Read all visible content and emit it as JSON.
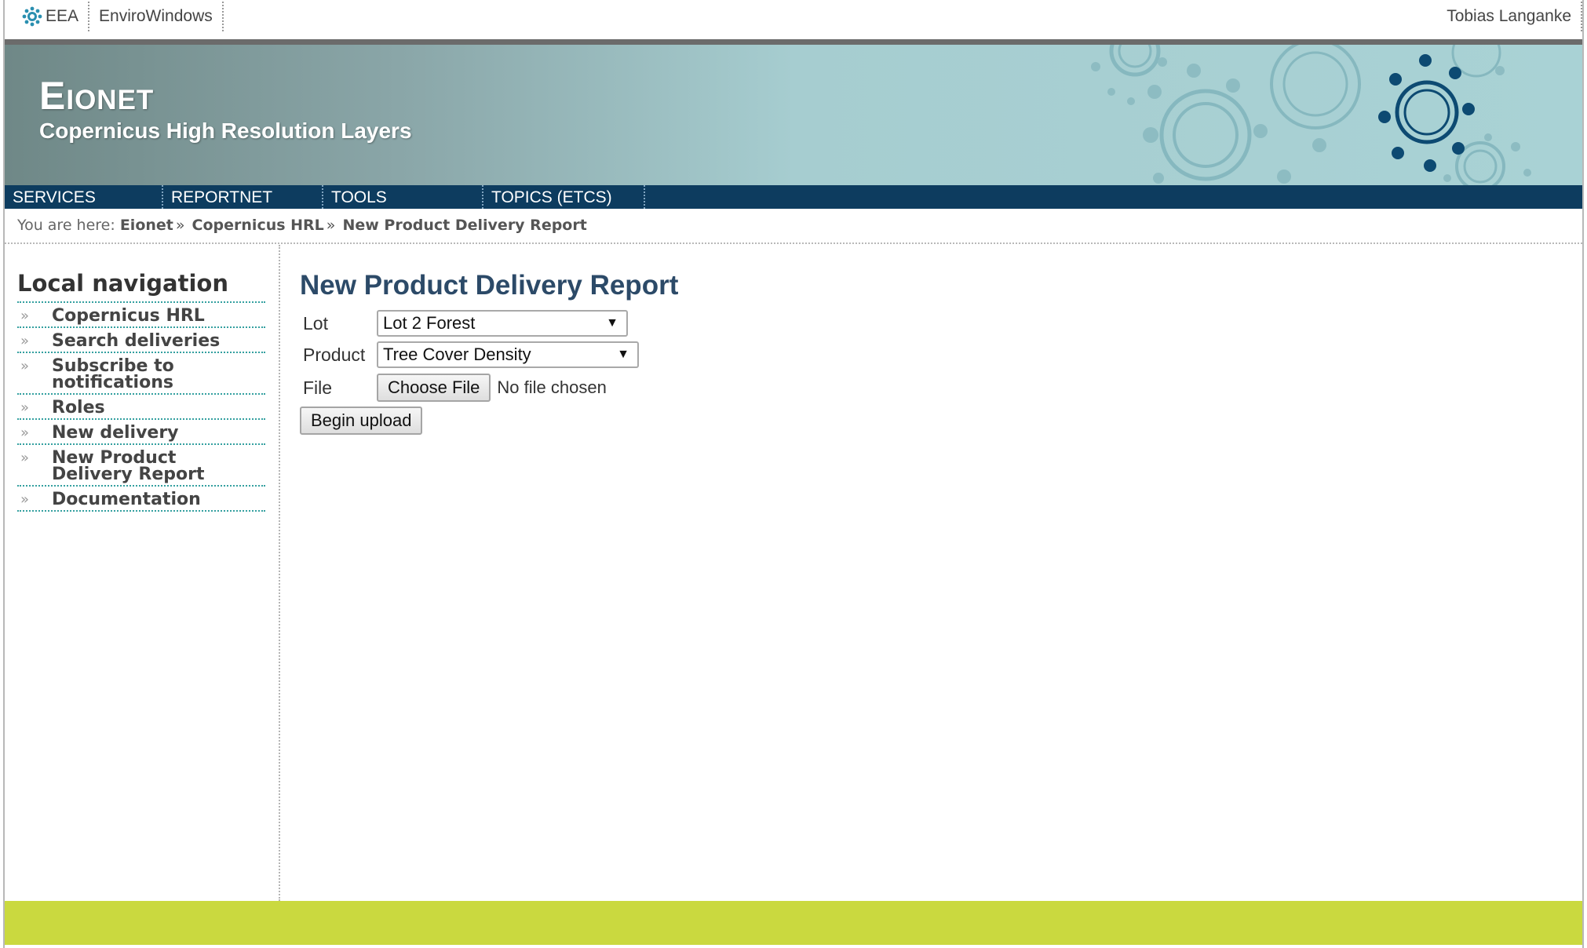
{
  "topbar": {
    "left_links": [
      "EEA",
      "EnviroWindows"
    ],
    "user": "Tobias Langanke"
  },
  "banner": {
    "title": "Eionet",
    "subtitle": "Copernicus High Resolution Layers"
  },
  "nav": {
    "items": [
      "SERVICES",
      "REPORTNET",
      "TOOLS",
      "TOPICS (ETCS)"
    ]
  },
  "breadcrumb": {
    "prefix": "You are here:",
    "items": [
      "Eionet",
      "Copernicus HRL",
      "New Product Delivery Report"
    ],
    "separator": "»"
  },
  "sidebar": {
    "title": "Local navigation",
    "items": [
      {
        "label": "Copernicus HRL"
      },
      {
        "label": "Search deliveries"
      },
      {
        "label": "Subscribe to notifications"
      },
      {
        "label": "Roles"
      },
      {
        "label": "New delivery"
      },
      {
        "label": "New Product Delivery Report"
      },
      {
        "label": "Documentation"
      }
    ],
    "bullet": "»"
  },
  "main": {
    "title": "New Product Delivery Report",
    "lot_label": "Lot",
    "lot_value": "Lot 2 Forest",
    "product_label": "Product",
    "product_value": "Tree Cover Density",
    "file_label": "File",
    "choose_file": "Choose File",
    "file_status": "No file chosen",
    "upload_button": "Begin upload"
  },
  "colors": {
    "nav_bg": "#0d3c5f",
    "footer_bg": "#cad93f",
    "title_color": "#2c4a68",
    "rule_teal": "#34a0a0"
  }
}
